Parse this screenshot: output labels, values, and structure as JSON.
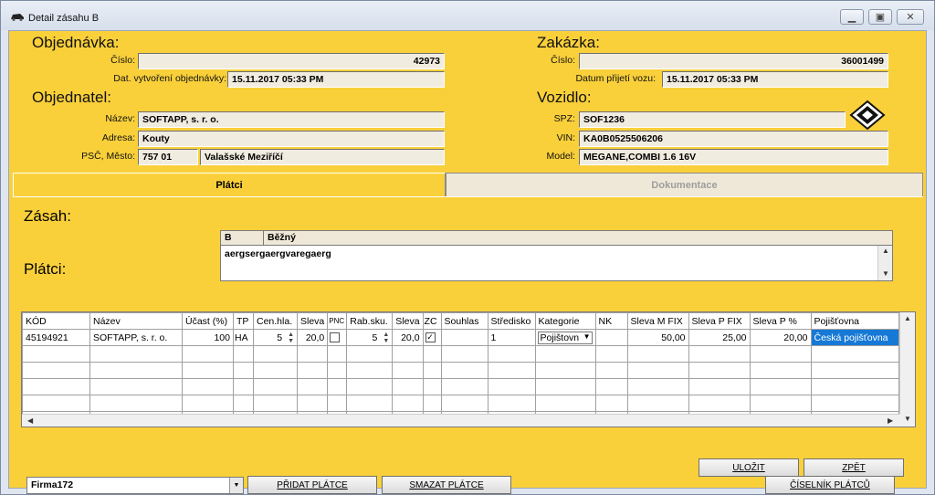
{
  "window": {
    "title": "Detail zásahu B",
    "controls": [
      "minimize-icon",
      "maximize-icon",
      "close-icon"
    ]
  },
  "objednavka": {
    "heading": "Objednávka:",
    "cislo_label": "Číslo:",
    "cislo": "42973",
    "datum_label": "Dat. vytvoření objednávky:",
    "datum": "15.11.2017 05:33 PM"
  },
  "objednatel": {
    "heading": "Objednatel:",
    "nazev_label": "Název:",
    "nazev": "SOFTAPP, s. r. o.",
    "adresa_label": "Adresa:",
    "adresa": "Kouty",
    "psc_label": "PSČ, Město:",
    "psc": "757 01",
    "mesto": "Valašské Meziříčí"
  },
  "zakazka": {
    "heading": "Zakázka:",
    "cislo_label": "Číslo:",
    "cislo": "36001499",
    "datum_label": "Datum přijetí vozu:",
    "datum": "15.11.2017 05:33 PM"
  },
  "vozidlo": {
    "heading": "Vozidlo:",
    "spz_label": "SPZ:",
    "spz": "SOF1236",
    "vin_label": "VIN:",
    "vin": "KA0B0525506206",
    "model_label": "Model:",
    "model": "MEGANE,COMBI 1.6 16V",
    "logo": "renault-logo-icon"
  },
  "tabs": [
    {
      "label": "Plátci",
      "active": true
    },
    {
      "label": "Dokumentace",
      "active": false
    }
  ],
  "zasah": {
    "heading": "Zásah:",
    "code": "B",
    "type": "Běžný",
    "text": "aergsergaergvaregaerg"
  },
  "platci": {
    "heading": "Plátci:",
    "columns": [
      "KÓD",
      "Název",
      "Účast (%)",
      "TP",
      "Cen.hla.",
      "Sleva",
      "PNC",
      "Rab.sku.",
      "Sleva",
      "ZC",
      "Souhlas",
      "Středisko",
      "Kategorie",
      "NK",
      "Sleva M FIX",
      "Sleva P FIX",
      "Sleva P %",
      "Pojišťovna"
    ],
    "row": {
      "kod": "45194921",
      "nazev": "SOFTAPP, s. r. o.",
      "ucast": "100",
      "tp": "HA",
      "cen_hla": "5",
      "sleva1": "20,0",
      "rab_sku": "5",
      "sleva2": "20,0",
      "zc_checked": true,
      "stredisko": "1",
      "kategorie": "Pojištovn",
      "sleva_m_fix": "50,00",
      "sleva_p_fix": "25,00",
      "sleva_p_pct": "20,00",
      "pojistovna": "Česká pojišťovna"
    }
  },
  "footer": {
    "firma_select": "Firma172",
    "pridat": "PŘIDAT PLÁTCE",
    "smazat": "SMAZAT PLÁTCE",
    "ciselnik": "ČÍSELNÍK PLÁTCŮ",
    "ulozit": "ULOŽIT",
    "zpet": "ZPĚT"
  },
  "colors": {
    "panel_bg": "#f9d03a",
    "field_bg": "#f1ece0",
    "selection": "#1679d6"
  }
}
